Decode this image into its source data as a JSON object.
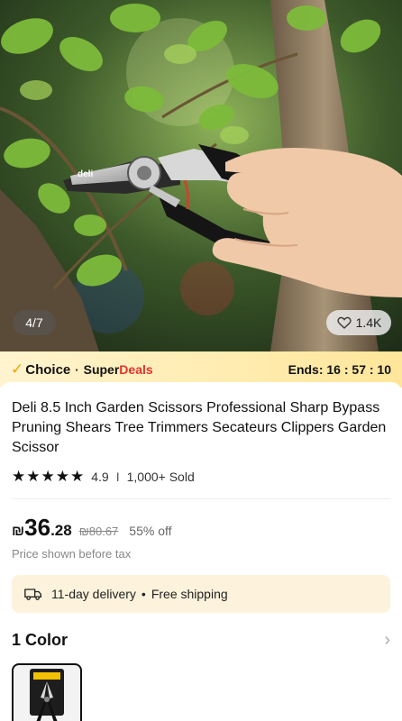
{
  "gallery": {
    "counter": "4/7",
    "favorites": "1.4K",
    "brand_on_product": "deli"
  },
  "deals": {
    "choice": "Choice",
    "separator": "·",
    "super": "Super",
    "deals": "Deals",
    "ends_label": "Ends: 16 : 57 : 10"
  },
  "product": {
    "title": "Deli 8.5 Inch Garden Scissors Professional Sharp Bypass Pruning Shears Tree Trimmers Secateurs Clippers Garden Scissor",
    "rating": "4.9",
    "sold": "1,000+ Sold",
    "stars": 5
  },
  "price": {
    "currency": "₪",
    "whole": "36",
    "cents": ".28",
    "original": "₪80.67",
    "discount": "55% off",
    "note": "Price shown before tax"
  },
  "delivery": {
    "days": "11-day delivery",
    "shipping": "Free shipping",
    "dot": "•"
  },
  "color": {
    "label": "1 Color"
  },
  "colors": {
    "accent_yellow": "#ffe69a",
    "deals_red": "#e4322b",
    "delivery_bg": "#fdf2dc"
  }
}
